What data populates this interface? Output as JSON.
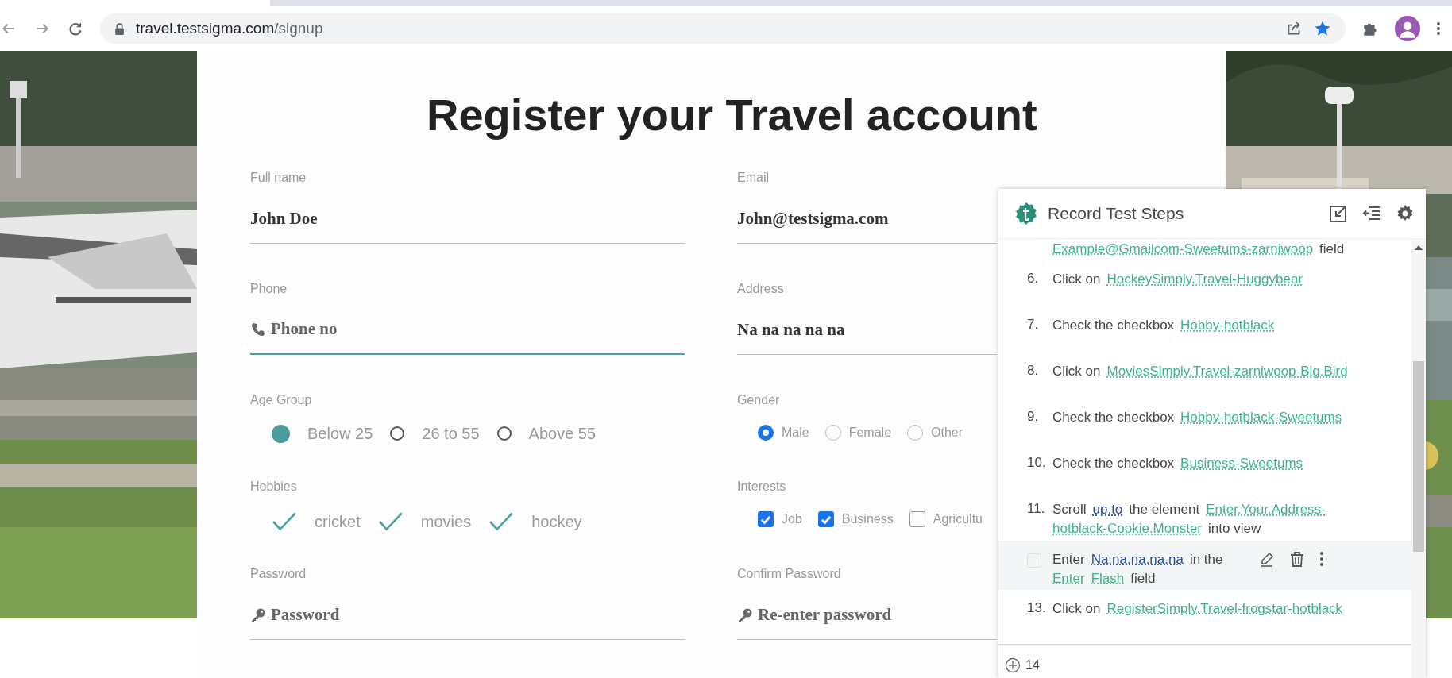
{
  "browser": {
    "url_host": "travel.testsigma.com",
    "url_path": "/signup"
  },
  "page": {
    "title": "Register your Travel account",
    "rows": [
      [
        {
          "kind": "text",
          "label": "Full name",
          "value": "John Doe",
          "focused": false
        },
        {
          "kind": "text",
          "label": "Email",
          "value": "John@testsigma.com",
          "focused": false
        }
      ],
      [
        {
          "kind": "phone",
          "label": "Phone",
          "placeholder": "Phone no",
          "focused": true
        },
        {
          "kind": "text",
          "label": "Address",
          "value": "Na na na na na",
          "focused": false
        }
      ],
      [
        {
          "kind": "big_radios",
          "label": "Age Group",
          "options": [
            {
              "label": "Below 25",
              "selected": true
            },
            {
              "label": "26 to 55",
              "selected": false
            },
            {
              "label": "Above 55",
              "selected": false
            }
          ]
        },
        {
          "kind": "small_radios",
          "label": "Gender",
          "options": [
            {
              "label": "Male",
              "selected": true
            },
            {
              "label": "Female",
              "selected": false
            },
            {
              "label": "Other",
              "selected": false
            }
          ]
        }
      ],
      [
        {
          "kind": "ticks",
          "label": "Hobbies",
          "options": [
            {
              "label": "cricket",
              "checked": true
            },
            {
              "label": "movies",
              "checked": true
            },
            {
              "label": "hockey",
              "checked": true
            }
          ]
        },
        {
          "kind": "checkboxes",
          "label": "Interests",
          "options": [
            {
              "label": "Job",
              "checked": true
            },
            {
              "label": "Business",
              "checked": true
            },
            {
              "label": "Agricultu",
              "checked": false
            }
          ]
        }
      ],
      [
        {
          "kind": "password",
          "label": "Password",
          "placeholder": "Password",
          "focused": false
        },
        {
          "kind": "password",
          "label": "Confirm Password",
          "placeholder": "Re-enter password",
          "focused": false
        }
      ]
    ]
  },
  "recorder": {
    "title": "Record Test Steps",
    "steps": [
      {
        "kind": "continuation",
        "parts": [
          {
            "kind": "link",
            "text": "Example@Gmailcom-Sweetums-zarniwoop"
          },
          {
            "kind": "text",
            "text": "field"
          }
        ]
      },
      {
        "kind": "step",
        "number": "6.",
        "parts": [
          {
            "kind": "text",
            "text": "Click on"
          },
          {
            "kind": "link",
            "text": "HockeySimply.Travel-Huggybear"
          }
        ]
      },
      {
        "kind": "step",
        "number": "7.",
        "parts": [
          {
            "kind": "text",
            "text": "Check the checkbox"
          },
          {
            "kind": "link",
            "text": "Hobby-hotblack"
          }
        ]
      },
      {
        "kind": "step",
        "number": "8.",
        "parts": [
          {
            "kind": "text",
            "text": "Click on"
          },
          {
            "kind": "link",
            "text": "MoviesSimply.Travel-zarniwoop-Big.Bird"
          }
        ]
      },
      {
        "kind": "step",
        "number": "9.",
        "parts": [
          {
            "kind": "text",
            "text": "Check the checkbox"
          },
          {
            "kind": "link",
            "text": "Hobby-hotblack-Sweetums"
          }
        ]
      },
      {
        "kind": "step",
        "number": "10.",
        "parts": [
          {
            "kind": "text",
            "text": "Check the checkbox"
          },
          {
            "kind": "link",
            "text": "Business-Sweetums"
          }
        ]
      },
      {
        "kind": "step",
        "number": "11.",
        "parts": [
          {
            "kind": "text",
            "text": "Scroll"
          },
          {
            "kind": "value",
            "text": "up.to"
          },
          {
            "kind": "text",
            "text": "the element"
          },
          {
            "kind": "link",
            "text": "Enter.Your.Address-"
          },
          {
            "kind": "link",
            "text": "hotblack-Cookie.Monster"
          },
          {
            "kind": "text",
            "text": "into view"
          }
        ]
      },
      {
        "kind": "hovered",
        "checked": false,
        "parts": [
          {
            "kind": "text",
            "text": "Enter"
          },
          {
            "kind": "value",
            "text": "Na.na.na.na.na"
          },
          {
            "kind": "text",
            "text": "in the"
          },
          {
            "kind": "link",
            "text": "Enter"
          },
          {
            "kind": "link",
            "text": "Flash"
          },
          {
            "kind": "text",
            "text": "field"
          }
        ]
      },
      {
        "kind": "step",
        "number": "13.",
        "parts": [
          {
            "kind": "text",
            "text": "Click on"
          },
          {
            "kind": "link",
            "text": "RegisterSimply.Travel-frogstar-hotblack"
          }
        ]
      },
      {
        "kind": "new",
        "number": "14"
      }
    ]
  }
}
